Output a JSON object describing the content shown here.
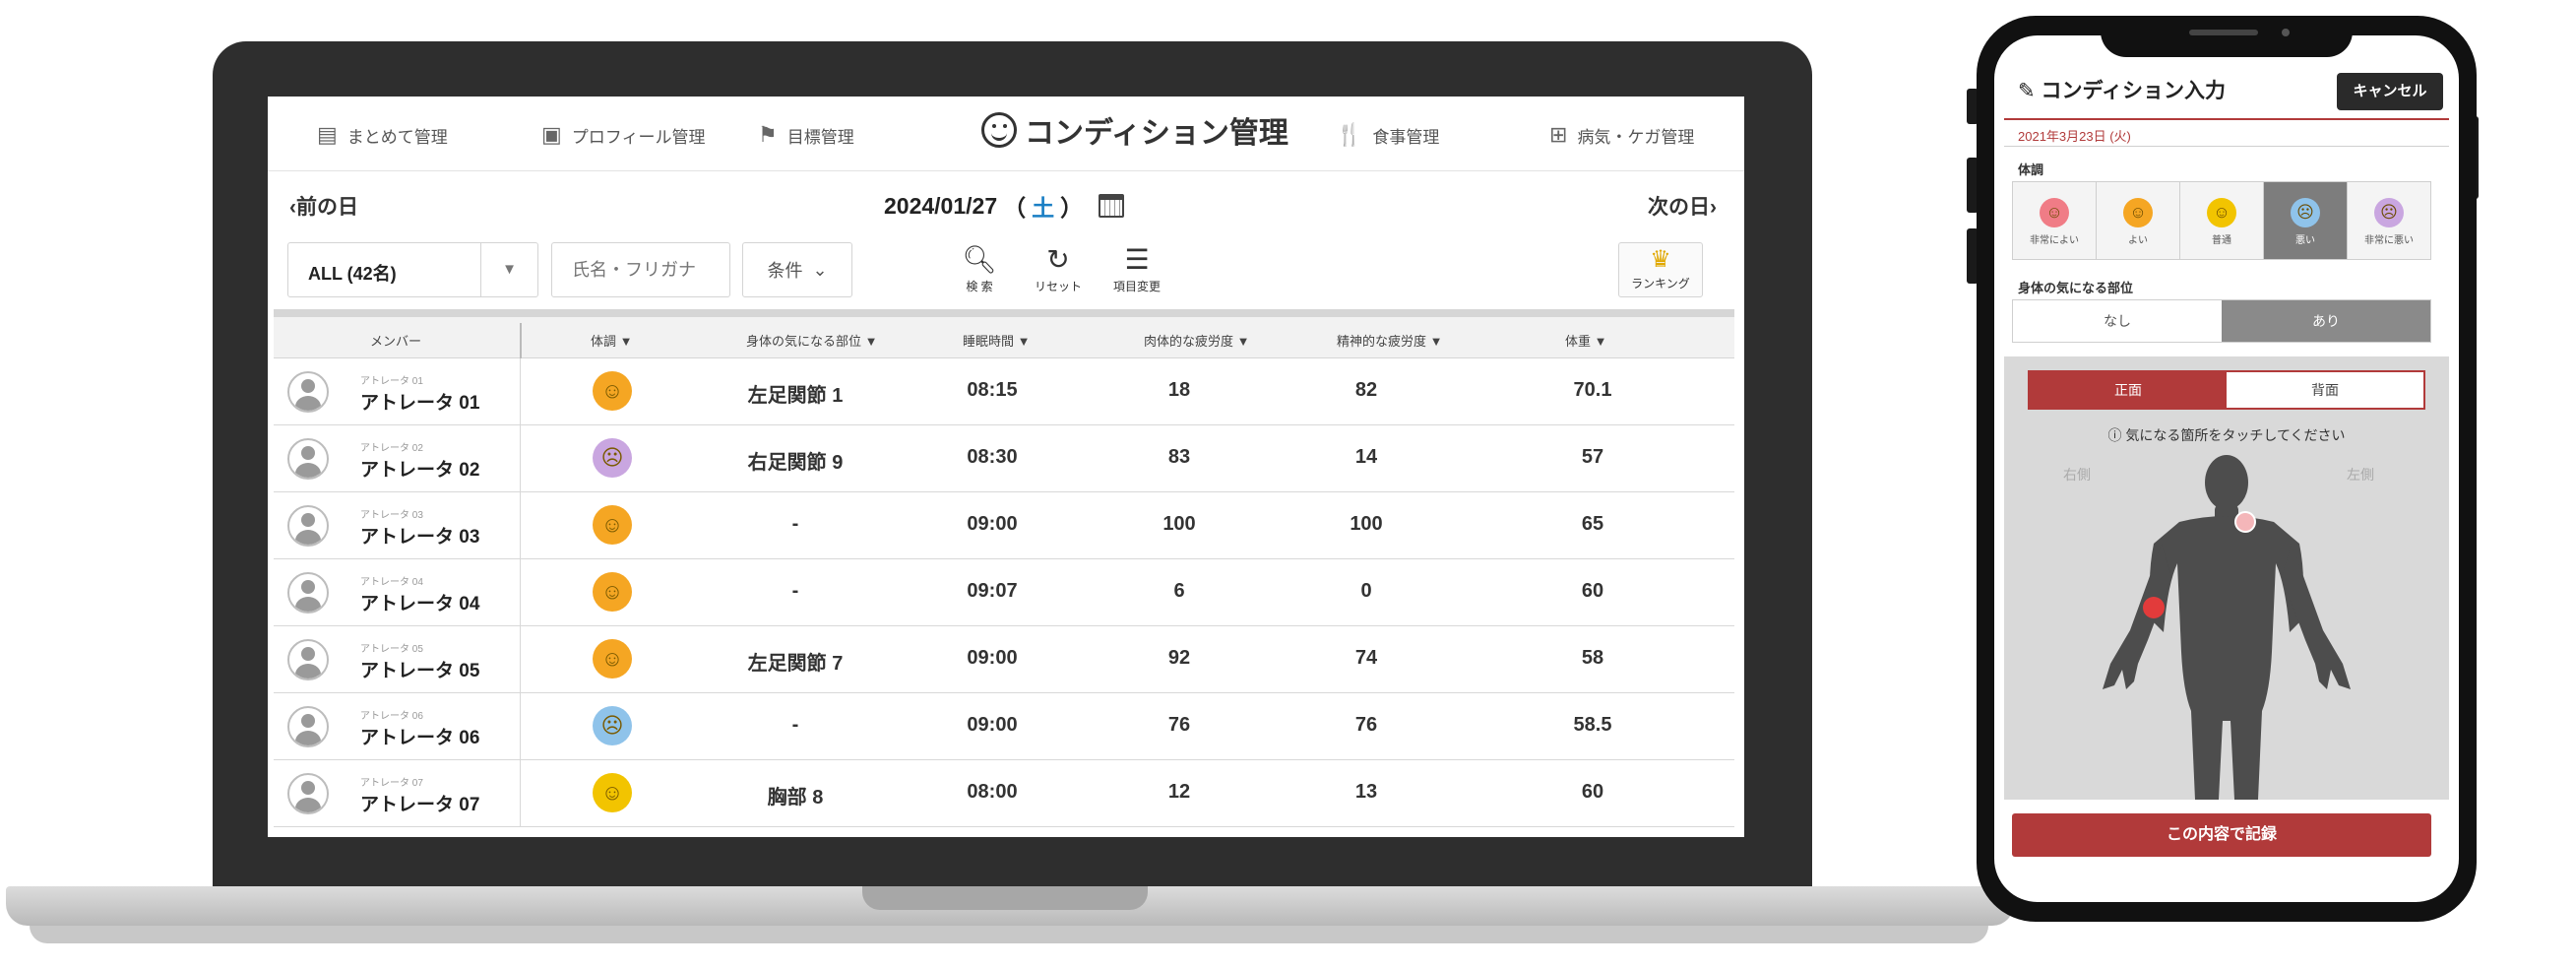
{
  "laptop": {
    "nav": {
      "items": [
        {
          "label": "まとめて管理",
          "icon": "clipboard-icon"
        },
        {
          "label": "プロフィール管理",
          "icon": "profile-icon"
        },
        {
          "label": "目標管理",
          "icon": "flag-icon"
        },
        {
          "label": "食事管理",
          "icon": "fork-knife-icon"
        },
        {
          "label": "病気・ケガ管理",
          "icon": "first-aid-icon"
        }
      ],
      "title": "コンディション管理"
    },
    "date_bar": {
      "prev": "前の日",
      "date": "2024/01/27",
      "weekday_open": "（",
      "weekday": "土",
      "weekday_close": "）",
      "next": "次の日"
    },
    "filters": {
      "group_select": "ALL (42名)",
      "name_placeholder": "氏名・フリガナ",
      "condition": "条件",
      "search": "検 索",
      "reset": "リセット",
      "columns": "項目変更",
      "ranking": "ランキング"
    },
    "table": {
      "headers": [
        "メンバー",
        "体調 ▼",
        "身体の気になる部位 ▼",
        "睡眠時間 ▼",
        "肉体的な疲労度 ▼",
        "精神的な疲労度 ▼",
        "体重 ▼"
      ],
      "rows": [
        {
          "sub": "アトレータ 01",
          "name": "アトレータ 01",
          "mood": "good",
          "part": "左足関節 1",
          "sleep": "08:15",
          "physical": "18",
          "mental": "82",
          "weight": "70.1"
        },
        {
          "sub": "アトレータ 02",
          "name": "アトレータ 02",
          "mood": "very-bad",
          "part": "右足関節 9",
          "sleep": "08:30",
          "physical": "83",
          "mental": "14",
          "weight": "57"
        },
        {
          "sub": "アトレータ 03",
          "name": "アトレータ 03",
          "mood": "good",
          "part": "-",
          "sleep": "09:00",
          "physical": "100",
          "mental": "100",
          "weight": "65"
        },
        {
          "sub": "アトレータ 04",
          "name": "アトレータ 04",
          "mood": "good",
          "part": "-",
          "sleep": "09:07",
          "physical": "6",
          "mental": "0",
          "weight": "60"
        },
        {
          "sub": "アトレータ 05",
          "name": "アトレータ 05",
          "mood": "good",
          "part": "左足関節 7",
          "sleep": "09:00",
          "physical": "92",
          "mental": "74",
          "weight": "58"
        },
        {
          "sub": "アトレータ 06",
          "name": "アトレータ 06",
          "mood": "bad",
          "part": "-",
          "sleep": "09:00",
          "physical": "76",
          "mental": "76",
          "weight": "58.5"
        },
        {
          "sub": "アトレータ 07",
          "name": "アトレータ 07",
          "mood": "normal",
          "part": "胸部 8",
          "sleep": "08:00",
          "physical": "12",
          "mental": "13",
          "weight": "60"
        }
      ]
    }
  },
  "phone": {
    "title": "コンディション入力",
    "cancel": "キャンセル",
    "date": "2021年3月23日 (火)",
    "condition_label": "体調",
    "condition_options": [
      {
        "label": "非常によい",
        "mood": "very-good"
      },
      {
        "label": "よい",
        "mood": "good"
      },
      {
        "label": "普通",
        "mood": "normal"
      },
      {
        "label": "悪い",
        "mood": "bad",
        "selected": true
      },
      {
        "label": "非常に悪い",
        "mood": "very-bad"
      }
    ],
    "body_part_label": "身体の気になる部位",
    "toggle": {
      "none": "なし",
      "some": "あり",
      "selected": "あり"
    },
    "view_toggle": {
      "front": "正面",
      "back": "背面",
      "selected": "正面"
    },
    "hint": "気になる箇所をタッチしてください",
    "side_right": "右側",
    "side_left": "左側",
    "record": "この内容で記録"
  },
  "colors": {
    "accent": "#b13a3a",
    "good_face": "#f5a623",
    "normal_face": "#f2c400",
    "bad_face": "#8fc3ea",
    "very_bad_face": "#c9a6e0",
    "very_good_face": "#f07c86",
    "marker_red": "#e23b3b",
    "marker_pink": "#f4b6b9"
  }
}
